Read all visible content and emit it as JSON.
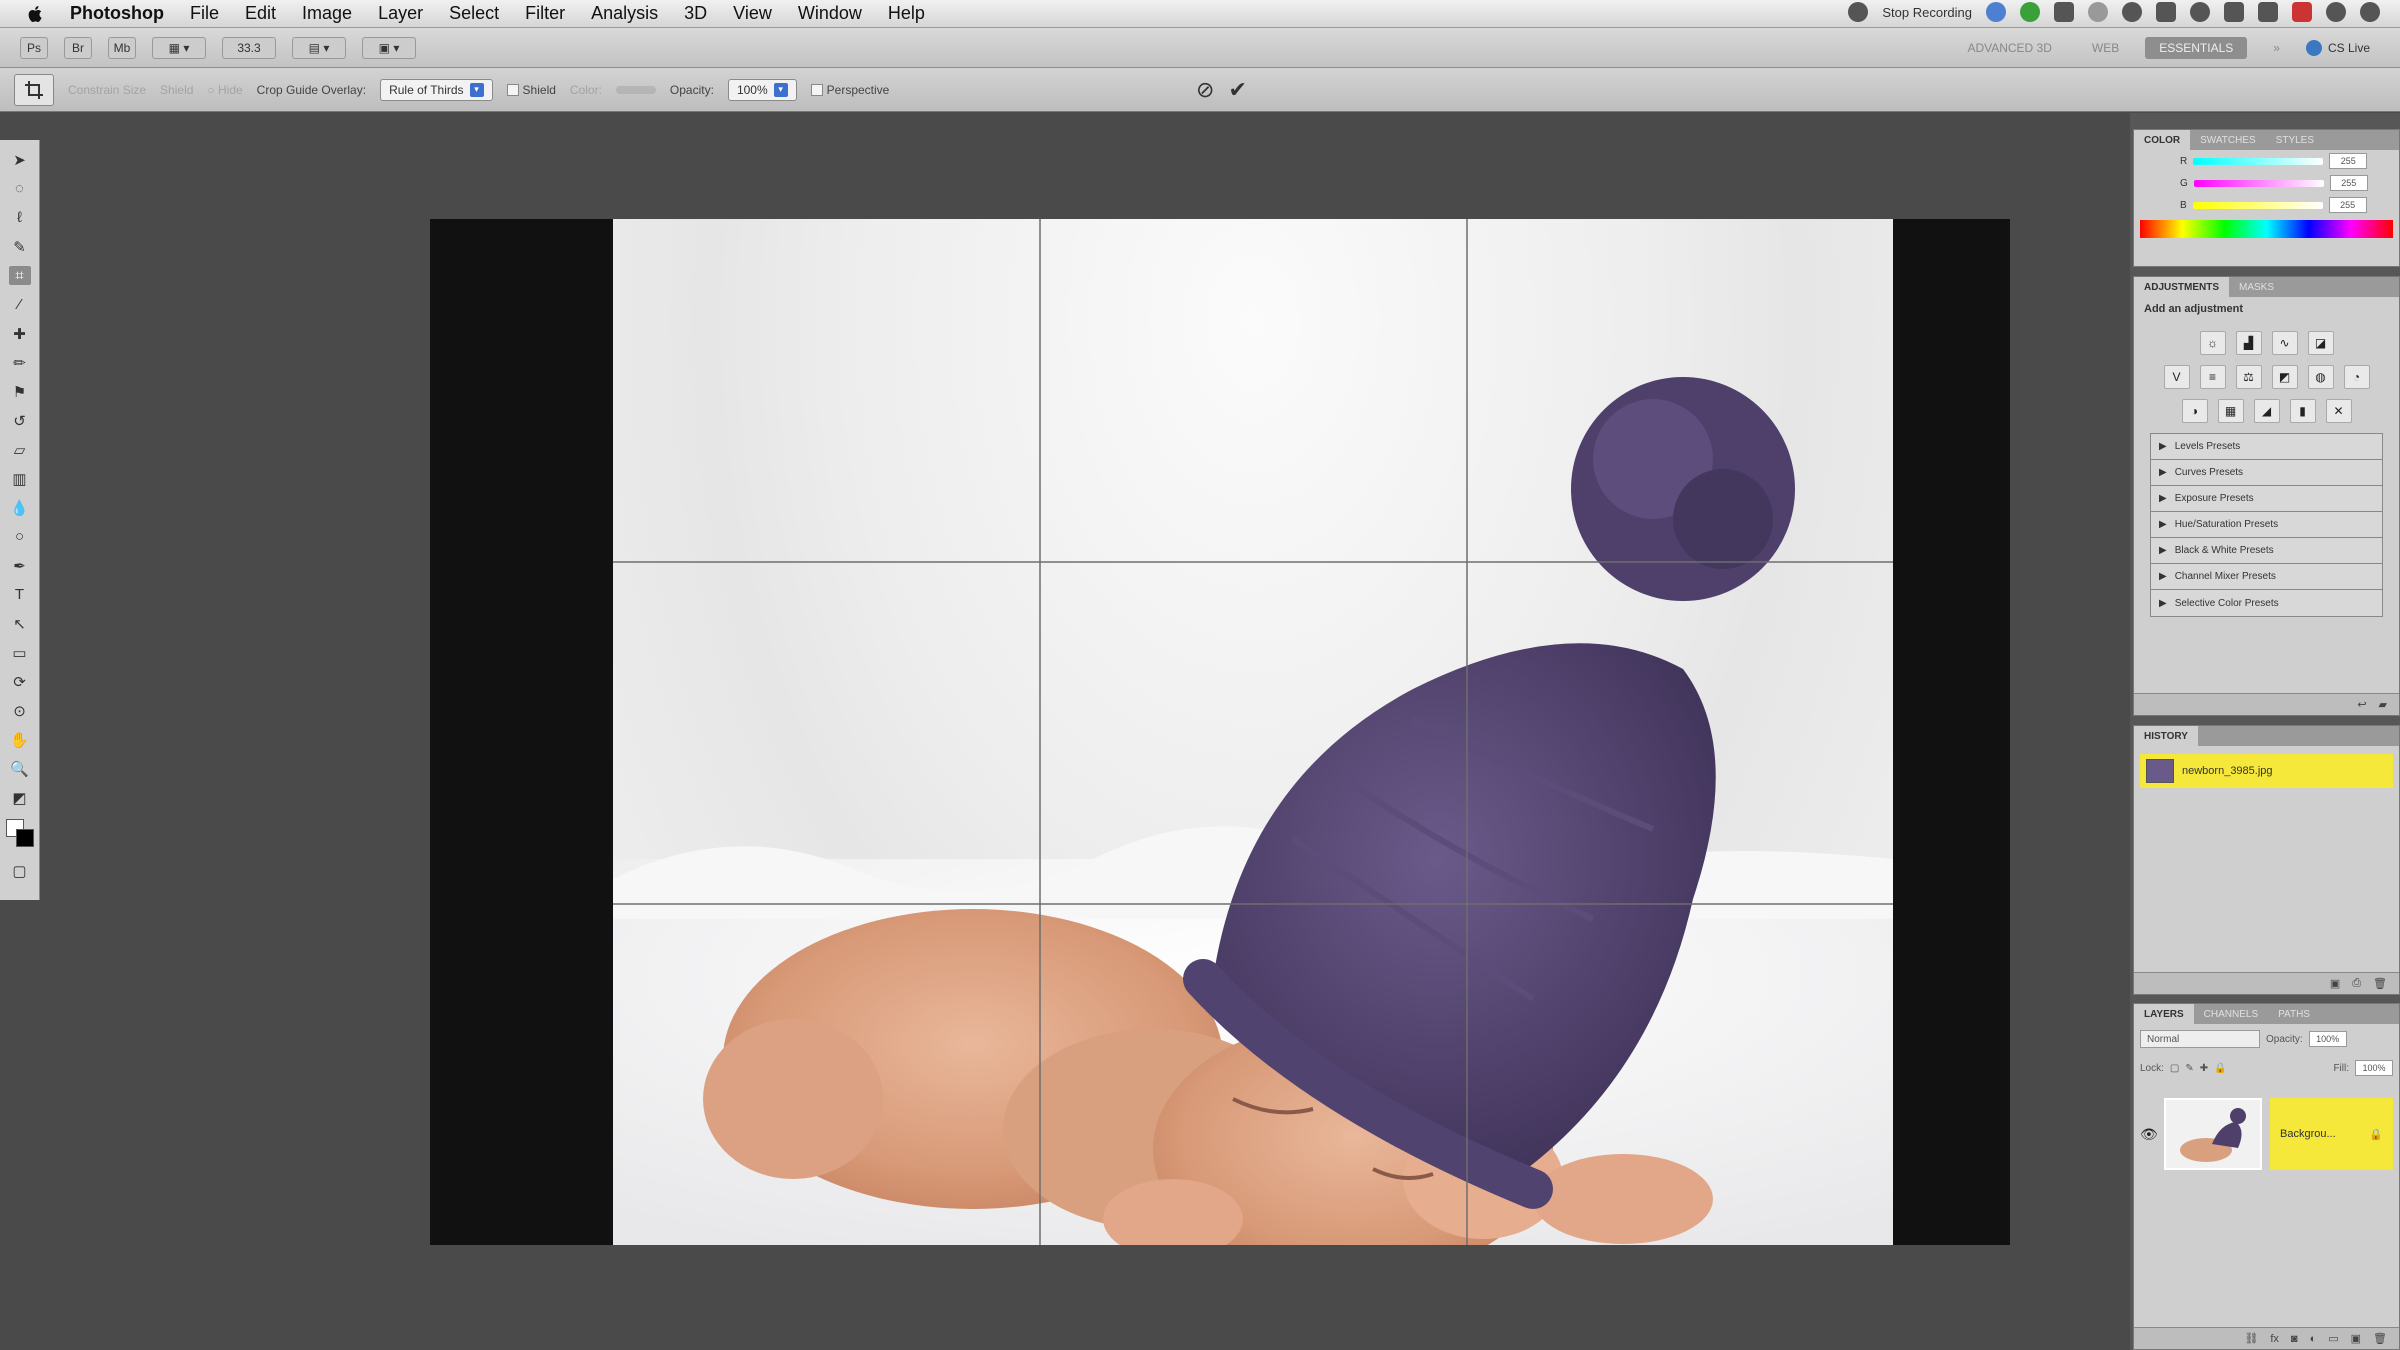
{
  "menubar": {
    "items": [
      "Photoshop",
      "File",
      "Edit",
      "Image",
      "Layer",
      "Select",
      "Filter",
      "Analysis",
      "3D",
      "View",
      "Window",
      "Help"
    ],
    "status_text": "Stop Recording"
  },
  "appbar": {
    "zoom_value": "33.3",
    "workspace_items": [
      "ADVANCED 3D",
      "WEB",
      "ESSENTIALS"
    ],
    "live_label": "CS Live"
  },
  "options": {
    "fixed_size": "Constrain Size",
    "shield": "Shield",
    "crop_guide_label": "Crop Guide Overlay:",
    "crop_guide_value": "Rule of Thirds",
    "shield_label": "Shield",
    "color_label": "Color:",
    "opacity_label": "Opacity:",
    "opacity_value": "100%",
    "perspective_label": "Perspective"
  },
  "panels": {
    "color": {
      "tabs": [
        "COLOR",
        "SWATCHES",
        "STYLES"
      ],
      "channel_labels": [
        "R",
        "G",
        "B"
      ],
      "values": [
        "255",
        "255",
        "255"
      ]
    },
    "adjustments": {
      "tabs": [
        "ADJUSTMENTS",
        "MASKS"
      ],
      "subtitle": "Add an adjustment",
      "presets": [
        "Levels Presets",
        "Curves Presets",
        "Exposure Presets",
        "Hue/Saturation Presets",
        "Black & White Presets",
        "Channel Mixer Presets",
        "Selective Color Presets"
      ]
    },
    "history": {
      "tabs": [
        "HISTORY"
      ],
      "state_label": "newborn_3985.jpg"
    },
    "layers": {
      "tabs": [
        "LAYERS",
        "CHANNELS",
        "PATHS"
      ],
      "blend_mode": "Normal",
      "opacity_label": "Opacity:",
      "opacity_value": "100%",
      "lock_label": "Lock:",
      "fill_label": "Fill:",
      "fill_value": "100%",
      "layer_name": "Backgrou..."
    }
  },
  "colors": {
    "accent_yellow": "#f5e83a",
    "canvas_bg": "#4a4a4a",
    "hat_purple": "#4e3f6b"
  },
  "icons": {
    "commit": "check-icon",
    "cancel": "cancel-icon"
  }
}
